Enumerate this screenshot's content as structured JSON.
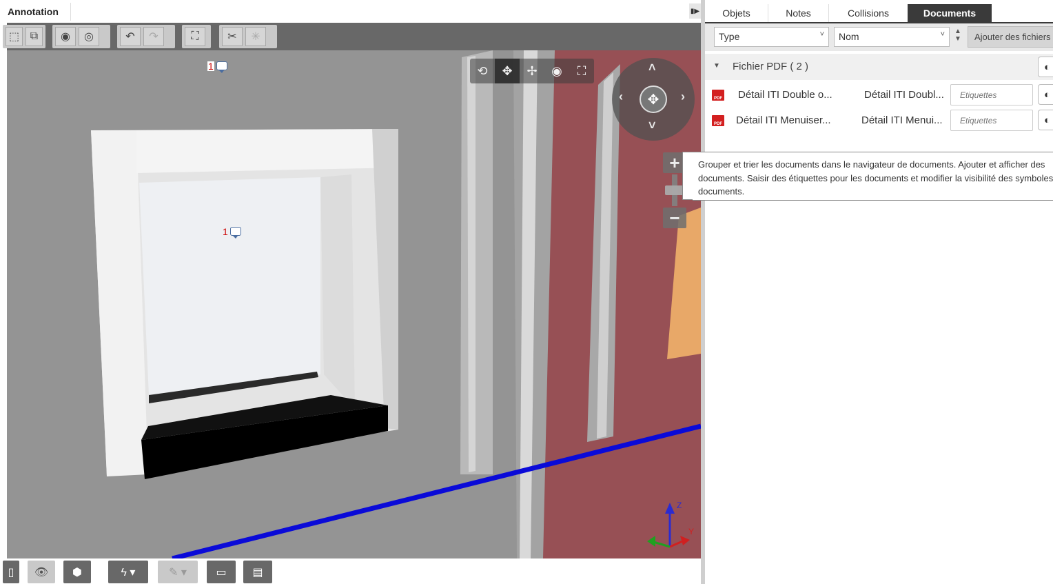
{
  "viewer": {
    "title": "Annotation",
    "markers": [
      {
        "number": "1"
      },
      {
        "number": "1"
      }
    ],
    "nav_tools": [
      "orbit-icon",
      "pan-icon",
      "move-icon",
      "look-icon",
      "fit-icon"
    ],
    "zoom": {
      "plus": "+",
      "minus": "−"
    },
    "axes": {
      "z": "Z",
      "y": "Y"
    }
  },
  "panel": {
    "tabs": [
      {
        "label": "Objets"
      },
      {
        "label": "Notes"
      },
      {
        "label": "Collisions"
      },
      {
        "label": "Documents",
        "active": true
      }
    ],
    "filters": {
      "group_by": "Type",
      "sort_by": "Nom",
      "add_files": "Ajouter des fichiers"
    },
    "group": {
      "label": "Fichier PDF ( 2 )"
    },
    "documents": [
      {
        "icon": "PDF",
        "name": "Détail ITI Double o...",
        "description": "Détail ITI Doubl...",
        "tags_placeholder": "Etiquettes"
      },
      {
        "icon": "PDF",
        "name": "Détail ITI Menuiser...",
        "description": "Détail ITI Menui...",
        "tags_placeholder": "Etiquettes"
      }
    ],
    "tooltip": "Grouper et trier les documents dans le navigateur de documents. Ajouter et afficher des documents. Saisir des étiquettes pour les documents et modifier la visibilité des symboles de documents."
  },
  "colors": {
    "toolbar_dark": "#686868",
    "tab_active": "#3a3a3a",
    "wall_red": "#975055",
    "line_blue": "#0a0ad8",
    "pdf_red": "#d32020"
  }
}
